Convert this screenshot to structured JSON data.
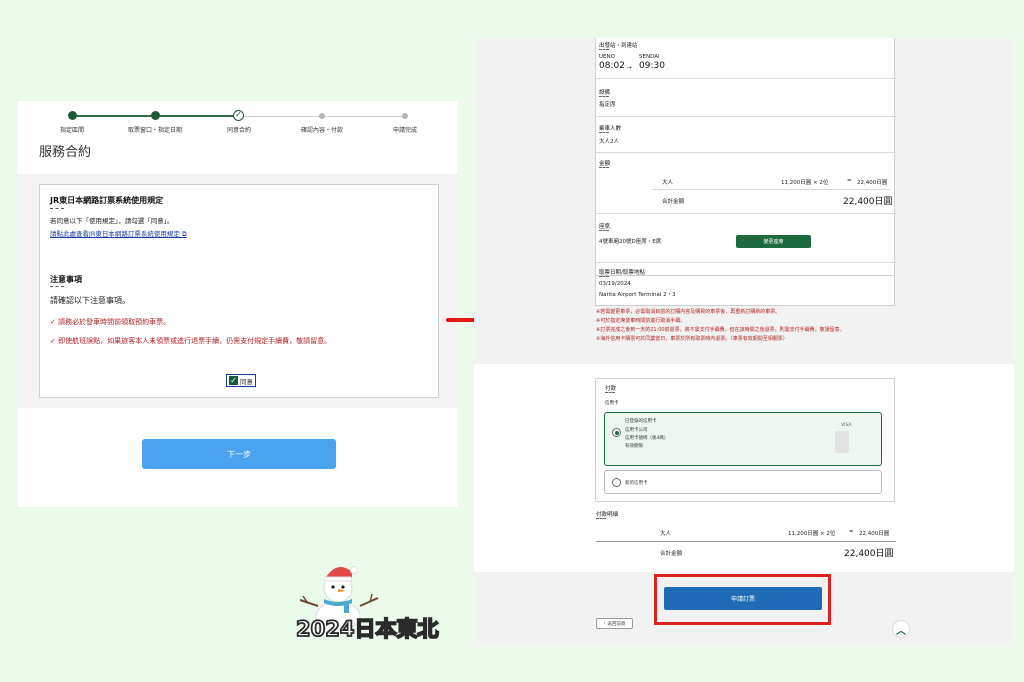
{
  "left": {
    "steps": [
      {
        "label": "指定區間",
        "state": "done"
      },
      {
        "label": "取票窗口・指定日期",
        "state": "done"
      },
      {
        "label": "同意合約",
        "state": "current"
      },
      {
        "label": "確認內容・付款",
        "state": "todo"
      },
      {
        "label": "申請完成",
        "state": "todo"
      }
    ],
    "title": "服務合約",
    "terms": {
      "heading": "JR東日本網路訂票系統使用規定",
      "line1": "若同意以下「使用規定」，請勾選「同意」。",
      "link": "請點此處查看JR東日本網路訂票系統使用規定",
      "notice_heading": "注意事項",
      "notice_intro": "請確認以下注意事項。",
      "notice_items": [
        "請務必於發車時間前領取預約車票。",
        "即使航班誤點，如果旅客本人未領票或進行退票手續，仍需支付規定手續費，敬請留意。"
      ],
      "agree_label": "同意"
    },
    "next_label": "下一步"
  },
  "right": {
    "route": {
      "heading": "出發站・到達站",
      "from_station": "UENO",
      "to_station": "SENDAI",
      "depart": "08:02",
      "arrive": "09:30"
    },
    "equipment": {
      "heading": "設備",
      "value": "指定席"
    },
    "passengers": {
      "heading": "乘車人數",
      "value": "大人2人"
    },
    "fare": {
      "heading": "金額",
      "category": "大人",
      "unit": "11,200日圓 × 2位",
      "eq": "=",
      "subtotal": "22,400日圓",
      "total_label": "合計金額",
      "total": "22,400日圓"
    },
    "seat": {
      "heading": "座席",
      "value": "4號車廂20號D座席・E席",
      "button": "變更座席"
    },
    "pickup": {
      "heading": "取票日期/取票地點",
      "date": "03/19/2024",
      "place": "Narita Airport Terminal 2・3"
    },
    "notes": [
      "※若需變更車票，必需取消目前的訂購內容及購買的車票後，再重新訂購新的車票。",
      "※可於指定席發車時間前進行取消手續。",
      "※訂票完成之後到一天的21:00前退票，將不需支付手續費，但在該時間之後退票，則需支付手續費，敬請留意。",
      "※海外信用卡購票可於同業當日，車票於所有取票時內退票。（車票有效期間至相關票）"
    ],
    "payment": {
      "heading": "付款",
      "sub": "信用卡",
      "options": [
        {
          "lines": [
            "已登錄的信用卡",
            "信用卡公司",
            "信用卡號碼（後4碼）",
            "有效期限"
          ],
          "brand": "VISA",
          "selected": true
        },
        {
          "lines": [
            "新的信用卡"
          ],
          "brand": "",
          "selected": false
        }
      ]
    },
    "payment_detail": {
      "heading": "付款明細",
      "category": "大人",
      "unit": "11,200日圓 × 2位",
      "eq": "=",
      "subtotal": "22,400日圓",
      "total_label": "合計金額",
      "total": "22,400日圓"
    },
    "submit_label": "申請訂票",
    "back_label": "返回前頁",
    "top_icon": "chevron-up-icon"
  },
  "mascot": {
    "text": "2024日本東北"
  },
  "colors": {
    "green": "#1c5a36",
    "blue_button": "#4aa3ef",
    "submit": "#1f6bb5",
    "highlight": "#e02020",
    "notice_red": "#b32222"
  }
}
